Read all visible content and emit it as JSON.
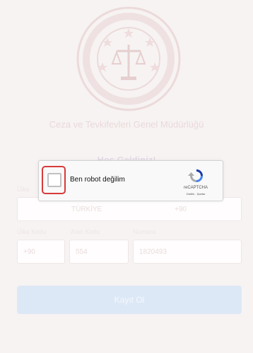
{
  "header": {
    "organization": "Ceza ve Tevkifevleri Genel Müdürlüğü",
    "welcome": "Hoş Geldiniz!"
  },
  "form": {
    "country_label": "Ülke",
    "country_value": "TÜRKİYE",
    "country_code_value": "+90",
    "code_label": "Ülke Kodu",
    "area_label": "Alan Kodu",
    "number_label": "Numara",
    "phone_country_code": "+90",
    "phone_area_code": "554",
    "phone_number": "1820493",
    "save_label": "Kayıt Ol"
  },
  "recaptcha": {
    "checkbox_label": "Ben robot değilim",
    "brand": "reCAPTCHA",
    "links": "Gizlilik - Şartlar",
    "highlight_color": "#d93a3a"
  }
}
